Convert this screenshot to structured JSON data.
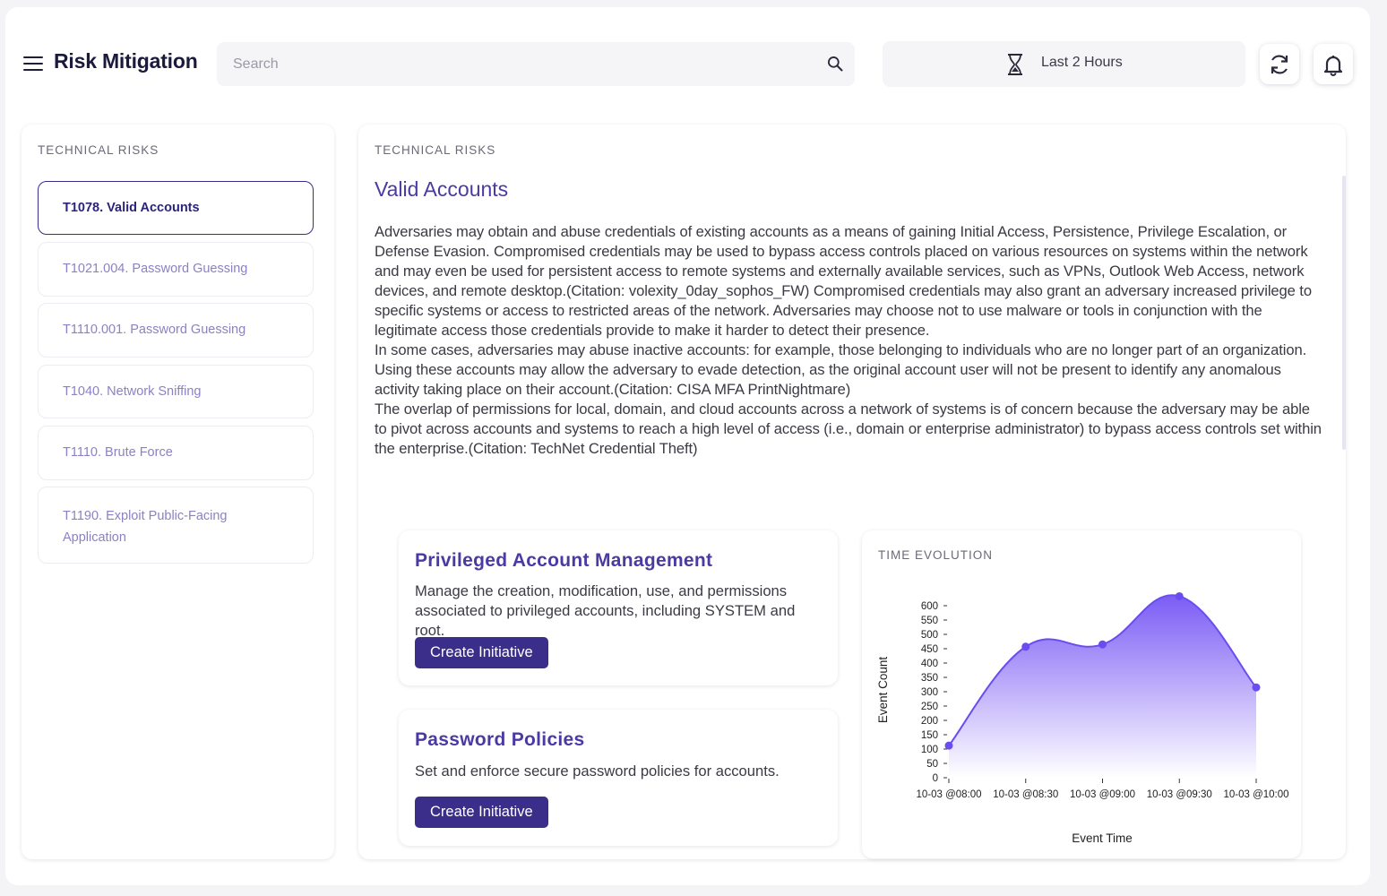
{
  "header": {
    "title": "Risk Mitigation",
    "search_placeholder": "Search",
    "time_range": "Last 2 Hours"
  },
  "sidebar": {
    "section_label": "TECHNICAL RISKS",
    "items": [
      {
        "label": "T1078. Valid Accounts",
        "active": true
      },
      {
        "label": "T1021.004. Password Guessing",
        "active": false
      },
      {
        "label": "T1110.001. Password Guessing",
        "active": false
      },
      {
        "label": "T1040. Network Sniffing",
        "active": false
      },
      {
        "label": "T1110. Brute Force",
        "active": false
      },
      {
        "label_line1": "T1190. Exploit Public-Facing",
        "label_line2": "Application",
        "active": false
      }
    ]
  },
  "detail": {
    "section_label": "TECHNICAL RISKS",
    "title": "Valid Accounts",
    "paragraphs": [
      "Adversaries may obtain and abuse credentials of existing accounts as a means of gaining Initial Access, Persistence, Privilege Escalation, or Defense Evasion. Compromised credentials may be used to bypass access controls placed on various resources on systems within the network and may even be used for persistent access to remote systems and externally available services, such as VPNs, Outlook Web Access, network devices, and remote desktop.(Citation: volexity_0day_sophos_FW) Compromised credentials may also grant an adversary increased privilege to specific systems or access to restricted areas of the network. Adversaries may choose not to use malware or tools in conjunction with the legitimate access those credentials provide to make it harder to detect their presence.",
      "In some cases, adversaries may abuse inactive accounts: for example, those belonging to individuals who are no longer part of an organization. Using these accounts may allow the adversary to evade detection, as the original account user will not be present to identify any anomalous activity taking place on their account.(Citation: CISA MFA PrintNightmare)",
      "The overlap of permissions for local, domain, and cloud accounts across a network of systems is of concern because the adversary may be able to pivot across accounts and systems to reach a high level of access (i.e., domain or enterprise administrator) to bypass access controls set within the enterprise.(Citation: TechNet Credential Theft)"
    ]
  },
  "mitigations": [
    {
      "title": "Privileged Account Management",
      "description": "Manage the creation, modification, use, and permissions associated to privileged accounts, including SYSTEM and root.",
      "button": "Create Initiative"
    },
    {
      "title": "Password Policies",
      "description": "Set and enforce secure password policies for accounts.",
      "button": "Create Initiative"
    }
  ],
  "chart_panel": {
    "section_label": "TIME EVOLUTION"
  },
  "chart_data": {
    "type": "area",
    "x": [
      "10-03 @08:00",
      "10-03 @08:30",
      "10-03 @09:00",
      "10-03 @09:30",
      "10-03 @10:00"
    ],
    "series": [
      {
        "values": [
          112,
          457,
          465,
          633,
          315
        ]
      }
    ],
    "xlabel": "Event Time",
    "ylabel": "Event Count",
    "ylim": [
      0,
      600
    ],
    "yticks": [
      0,
      50,
      100,
      150,
      200,
      250,
      300,
      350,
      400,
      450,
      500,
      550,
      600
    ],
    "grid": false,
    "colors": {
      "line": "#6a4cf0",
      "fill_top": "#7b5cf5",
      "fill_bottom": "#ffffff"
    }
  },
  "colors": {
    "accent": "#3b2e8a",
    "title_purple": "#4b3aa3",
    "inactive_item": "#8a82c4"
  }
}
